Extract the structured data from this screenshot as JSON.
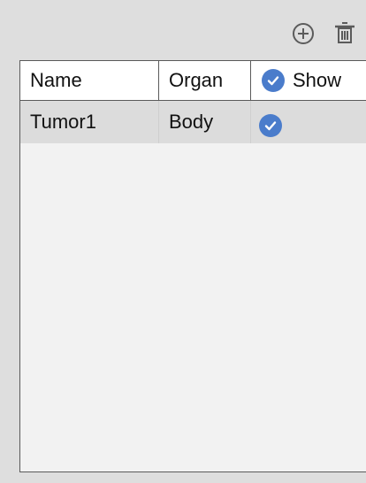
{
  "toolbar": {
    "add_icon": "circle-plus-icon",
    "delete_icon": "trash-icon"
  },
  "table": {
    "columns": [
      "Name",
      "Organ",
      "Show"
    ],
    "rows": [
      {
        "name": "Tumor1",
        "organ": "Body",
        "show": true
      }
    ]
  },
  "colors": {
    "check_blue": "#4a7ccb",
    "panel_bg": "#dedede",
    "header_bg": "#ffffff",
    "selected_row_bg": "#dcdcdc",
    "table_bg": "#f2f2f2"
  }
}
